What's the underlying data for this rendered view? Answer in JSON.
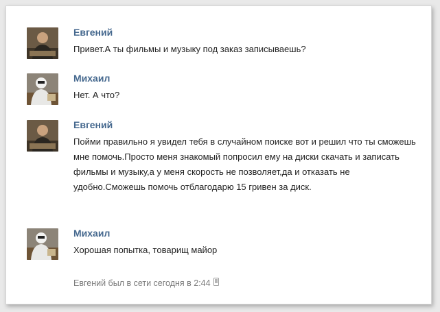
{
  "messages": [
    {
      "author": "Евгений",
      "avatar": "evgeny-photo",
      "text": "Привет.А ты фильмы и музыку под заказ записываешь?"
    },
    {
      "author": "Михаил",
      "avatar": "mikhail-photo",
      "text": "Нет. А что?"
    },
    {
      "author": "Евгений",
      "avatar": "evgeny-photo",
      "text": "Пойми правильно я увидел тебя в случайном поиске вот и решил что ты сможешь мне помочь.Просто меня знакомый попросил ему на диски скачать и записать фильмы и музыку,а у меня скорость не позволяет,да и отказать не удобно.Сможешь помочь отблагодарю 15 гривен за диск."
    },
    {
      "author": "Михаил",
      "avatar": "mikhail-photo",
      "text": "Хорошая попытка, товарищ майор"
    }
  ],
  "status": {
    "text": "Евгений был в сети сегодня в 2:44",
    "icon": "mobile-phone-icon"
  },
  "colors": {
    "author": "#45688e",
    "text": "#222222",
    "status": "#7a7a7a"
  }
}
